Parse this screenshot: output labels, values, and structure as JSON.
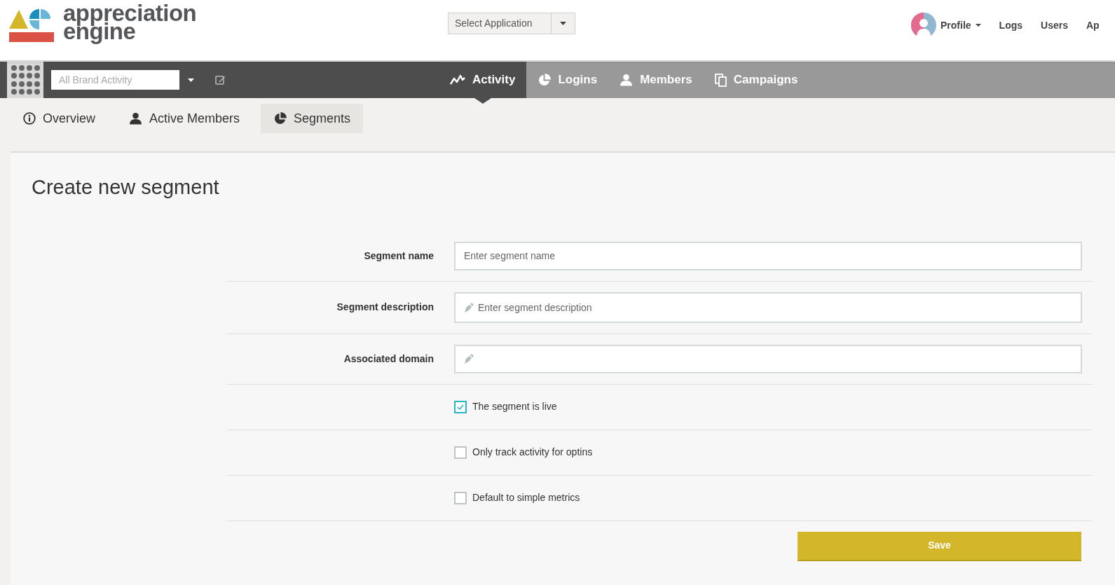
{
  "header": {
    "logo_lines": [
      "appreciation",
      "engine"
    ],
    "app_select": {
      "placeholder": "Select Application"
    },
    "nav": [
      {
        "label": "Profile",
        "kind": "profile"
      },
      {
        "label": "Logs",
        "kind": "link"
      },
      {
        "label": "Users",
        "kind": "link"
      },
      {
        "label": "Ap",
        "kind": "link"
      }
    ]
  },
  "toolbar": {
    "brand_select": {
      "placeholder": "All Brand Activity"
    },
    "tabs": [
      {
        "label": "Activity",
        "selected": true
      },
      {
        "label": "Logins",
        "selected": false
      },
      {
        "label": "Members",
        "selected": false
      },
      {
        "label": "Campaigns",
        "selected": false
      }
    ]
  },
  "subtabs": [
    {
      "label": "Overview",
      "selected": false
    },
    {
      "label": "Active Members",
      "selected": false
    },
    {
      "label": "Segments",
      "selected": true
    }
  ],
  "form": {
    "title": "Create new segment",
    "fields": [
      {
        "kind": "text",
        "label": "Segment name",
        "placeholder": "Enter segment name"
      },
      {
        "kind": "textarea",
        "label": "Segment description",
        "placeholder": "Enter segment description"
      },
      {
        "kind": "pen",
        "label": "Associated domain"
      }
    ],
    "checkboxes": [
      {
        "label": "The segment is live",
        "checked": true
      },
      {
        "label": "Only track activity for optins",
        "checked": false
      },
      {
        "label": "Default to simple metrics",
        "checked": false
      }
    ],
    "save_button": "Save"
  }
}
